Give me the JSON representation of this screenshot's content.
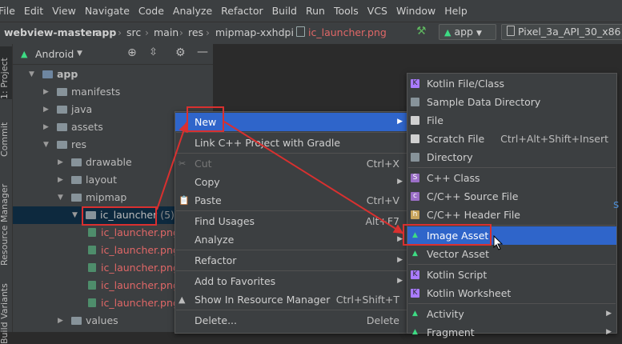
{
  "menubar": [
    "File",
    "Edit",
    "View",
    "Navigate",
    "Code",
    "Analyze",
    "Refactor",
    "Build",
    "Run",
    "Tools",
    "VCS",
    "Window",
    "Help"
  ],
  "breadcrumb": [
    "webview-master",
    "app",
    "src",
    "main",
    "res",
    "mipmap-xxhdpi",
    "ic_launcher.png"
  ],
  "run_config": "app",
  "device": "Pixel_3a_API_30_x86",
  "side_tabs": {
    "project": "1: Project",
    "commit": "Commit",
    "resource_manager": "Resource Manager",
    "build_variants": "Build Variants"
  },
  "panel": {
    "view_mode": "Android"
  },
  "tree": [
    {
      "label": "app",
      "level": 0,
      "open": true
    },
    {
      "label": "manifests",
      "level": 1,
      "open": false
    },
    {
      "label": "java",
      "level": 1,
      "open": false
    },
    {
      "label": "assets",
      "level": 1,
      "open": false
    },
    {
      "label": "res",
      "level": 1,
      "open": true
    },
    {
      "label": "drawable",
      "level": 2,
      "open": false
    },
    {
      "label": "layout",
      "level": 2,
      "open": false
    },
    {
      "label": "mipmap",
      "level": 2,
      "open": true
    },
    {
      "label": "ic_launcher",
      "count": "(5)",
      "level": 3,
      "open": true
    },
    {
      "label": "ic_launcher.png",
      "level": 4
    },
    {
      "label": "ic_launcher.png",
      "level": 4
    },
    {
      "label": "ic_launcher.png",
      "level": 4
    },
    {
      "label": "ic_launcher.png",
      "level": 4
    },
    {
      "label": "ic_launcher.png",
      "level": 4
    },
    {
      "label": "values",
      "level": 2,
      "open": false
    }
  ],
  "context_menu": [
    {
      "label": "New",
      "shortcut": "",
      "submenu": true,
      "highlight": true
    },
    {
      "sep": true
    },
    {
      "label": "Link C++ Project with Gradle",
      "shortcut": ""
    },
    {
      "sep": true
    },
    {
      "label": "Cut",
      "shortcut": "Ctrl+X",
      "disabled": true
    },
    {
      "label": "Copy",
      "shortcut": "",
      "submenu": true
    },
    {
      "label": "Paste",
      "shortcut": "Ctrl+V"
    },
    {
      "sep": true
    },
    {
      "label": "Find Usages",
      "shortcut": "Alt+F7"
    },
    {
      "label": "Analyze",
      "shortcut": "",
      "submenu": true
    },
    {
      "sep": true
    },
    {
      "label": "Refactor",
      "shortcut": "",
      "submenu": true
    },
    {
      "sep": true
    },
    {
      "label": "Add to Favorites",
      "shortcut": "",
      "submenu": true
    },
    {
      "label": "Show In Resource Manager",
      "shortcut": "Ctrl+Shift+T"
    },
    {
      "sep": true
    },
    {
      "label": "Delete...",
      "shortcut": "Delete"
    }
  ],
  "new_menu": [
    {
      "label": "Kotlin File/Class",
      "icon": "kotlin-icon"
    },
    {
      "label": "Sample Data Directory",
      "icon": "folder-icon"
    },
    {
      "label": "File",
      "icon": "file-icon"
    },
    {
      "label": "Scratch File",
      "shortcut": "Ctrl+Alt+Shift+Insert",
      "icon": "scratch-icon"
    },
    {
      "label": "Directory",
      "icon": "folder-icon"
    },
    {
      "sep": true
    },
    {
      "label": "C++ Class",
      "icon": "cpp-class-icon"
    },
    {
      "label": "C/C++ Source File",
      "icon": "cpp-source-icon"
    },
    {
      "label": "C/C++ Header File",
      "icon": "cpp-header-icon"
    },
    {
      "sep": true
    },
    {
      "label": "Image Asset",
      "icon": "android-icon",
      "highlight": true
    },
    {
      "label": "Vector Asset",
      "icon": "android-icon"
    },
    {
      "sep": true
    },
    {
      "label": "Kotlin Script",
      "icon": "kotlin-icon"
    },
    {
      "label": "Kotlin Worksheet",
      "icon": "kotlin-icon"
    },
    {
      "sep": true
    },
    {
      "label": "Activity",
      "icon": "android-icon",
      "submenu": true
    },
    {
      "label": "Fragment",
      "icon": "android-icon",
      "submenu": true
    }
  ],
  "colors": {
    "highlight": "#2f65ca",
    "annotation_red": "#d9302f",
    "android_green": "#3ddc84"
  }
}
